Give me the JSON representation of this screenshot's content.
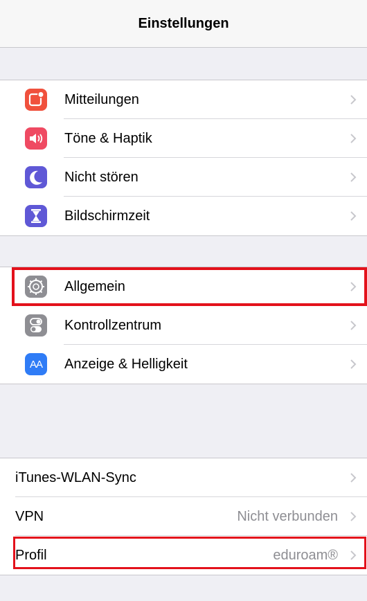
{
  "header": {
    "title": "Einstellungen"
  },
  "group1": [
    {
      "label": "Mitteilungen",
      "icon": "notifications-icon",
      "color": "#f0513d"
    },
    {
      "label": "Töne & Haptik",
      "icon": "sound-icon",
      "color": "#ef4a62"
    },
    {
      "label": "Nicht stören",
      "icon": "moon-icon",
      "color": "#5f58d6"
    },
    {
      "label": "Bildschirmzeit",
      "icon": "hourglass-icon",
      "color": "#5f58d6"
    }
  ],
  "group2": [
    {
      "label": "Allgemein",
      "icon": "gear-icon",
      "color": "#8e8e93"
    },
    {
      "label": "Kontrollzentrum",
      "icon": "toggles-icon",
      "color": "#8e8e93"
    },
    {
      "label": "Anzeige & Helligkeit",
      "icon": "display-icon",
      "color": "#2f7cf6",
      "icon_text": "AA"
    }
  ],
  "group3": [
    {
      "label": "iTunes-WLAN-Sync",
      "value": ""
    },
    {
      "label": "VPN",
      "value": "Nicht verbunden"
    },
    {
      "label": "Profil",
      "value": "eduroam®"
    }
  ],
  "colors": {
    "highlight": "#e3111b",
    "chevron": "#c7c7cc"
  }
}
